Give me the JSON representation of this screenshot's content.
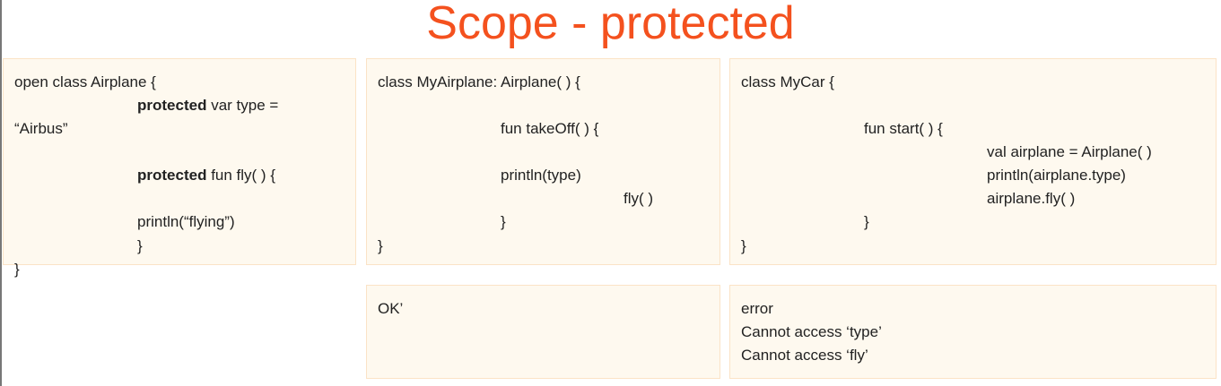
{
  "title": "Scope - protected",
  "airplane": {
    "l1": "open class Airplane {",
    "kw": "protected",
    "l2": " var type =",
    "l3": "“Airbus”",
    "l4": " fun fly( ) {",
    "l5": "println(“flying”)",
    "l6": "}",
    "l7": "}"
  },
  "my_airplane": {
    "l1": "class MyAirplane: Airplane( ) {",
    "l2": "fun takeOff( ) {",
    "l3": "println(type)",
    "l4": "fly( )",
    "l5": "}",
    "l6": "}"
  },
  "my_car": {
    "l1": "class MyCar {",
    "l2": "fun start( ) {",
    "l3": "val airplane = Airplane( )",
    "l4": "println(airplane.type)",
    "l5": "airplane.fly( )",
    "l6": "}",
    "l7": "}"
  },
  "result_ok": "OK’",
  "result_error": {
    "l1": "error",
    "l2": "Cannot access ‘type’",
    "l3": "Cannot access ‘fly’"
  }
}
